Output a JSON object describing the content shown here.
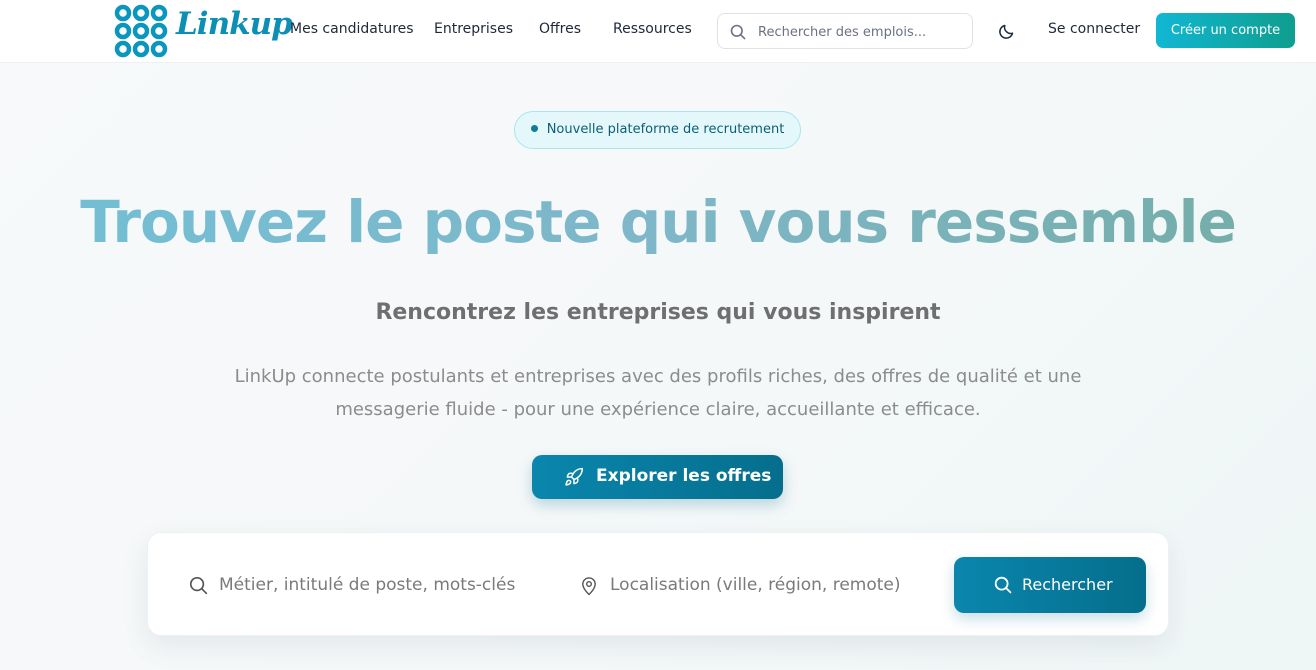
{
  "header": {
    "brand": "Linkup",
    "nav": [
      {
        "label": "Mes candidatures"
      },
      {
        "label": "Entreprises"
      },
      {
        "label": "Offres"
      },
      {
        "label": "Ressources"
      }
    ],
    "search": {
      "placeholder": "Rechercher des emplois...",
      "icon": "search-icon"
    },
    "theme_toggle_icon": "moon-icon",
    "login_label": "Se connecter",
    "signup_label": "Créer un compte"
  },
  "hero": {
    "badge": "Nouvelle plateforme de recrutement",
    "title": "Trouvez le poste qui vous ressemble",
    "subtitle": "Rencontrez les entreprises qui vous inspirent",
    "description": "LinkUp connecte postulants et entreprises avec des profils riches, des offres de qualité et une messagerie fluide - pour une expérience claire, accueillante et efficace.",
    "cta_label": "Explorer les offres",
    "cta_icon": "rocket-icon"
  },
  "search_card": {
    "job_placeholder": "Métier, intitulé de poste, mots-clés",
    "job_icon": "search-icon",
    "location_placeholder": "Localisation (ville, région, remote)",
    "location_icon": "map-pin-icon",
    "button_label": "Rechercher"
  },
  "colors": {
    "brand": "#0b8fb5",
    "primary_button": "#0a86ad",
    "signup_gradient_start": "#11b7d3",
    "signup_gradient_end": "#0f9e8e",
    "badge_background": "#e4f8fb"
  }
}
